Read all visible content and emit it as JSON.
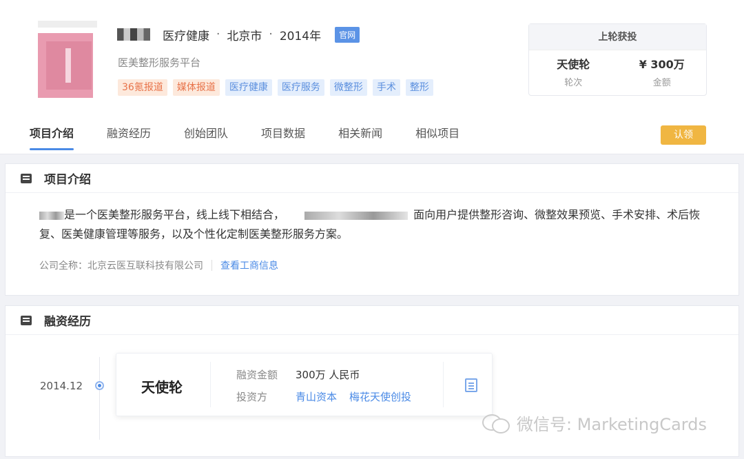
{
  "header": {
    "industry": "医疗健康",
    "city": "北京市",
    "year": "2014年",
    "dot_sep": "·",
    "official_label": "官网",
    "subtitle": "医美整形服务平台",
    "tags": [
      {
        "label": "36氪报道",
        "style": "red"
      },
      {
        "label": "媒体报道",
        "style": "red"
      },
      {
        "label": "医疗健康",
        "style": "blue"
      },
      {
        "label": "医疗服务",
        "style": "blue"
      },
      {
        "label": "微整形",
        "style": "blue"
      },
      {
        "label": "手术",
        "style": "blue"
      },
      {
        "label": "整形",
        "style": "blue"
      }
    ]
  },
  "last_round": {
    "title": "上轮获投",
    "round_value": "天使轮",
    "round_caption": "轮次",
    "amount_value": "¥ 300万",
    "amount_caption": "金额"
  },
  "tabs": [
    "项目介绍",
    "融资经历",
    "创始团队",
    "项目数据",
    "相关新闻",
    "相似项目"
  ],
  "claim_label": "认领",
  "intro": {
    "title": "项目介绍",
    "text_a": "是一个医美整形服务平台，线上线下相结合，",
    "text_b": "面向用户提供整形咨询、微整效果预览、手术安排、术后恢复、医美健康管理等服务，以及个性化定制医美整形服务方案。",
    "company_label": "公司全称：",
    "company_name": "北京云医互联科技有限公司",
    "check_link": "查看工商信息"
  },
  "funding": {
    "title": "融资经历",
    "date": "2014.12",
    "round": "天使轮",
    "amount_label": "融资金额",
    "amount": "300万 人民币",
    "investor_label": "投资方",
    "investors": [
      "青山资本",
      "梅花天使创投"
    ]
  },
  "watermark": "微信号: MarketingCards",
  "colors": {
    "accent": "#4a8ae6",
    "claim": "#f0b642",
    "tag_red": "#e8734a",
    "tag_blue": "#5b8fde"
  }
}
